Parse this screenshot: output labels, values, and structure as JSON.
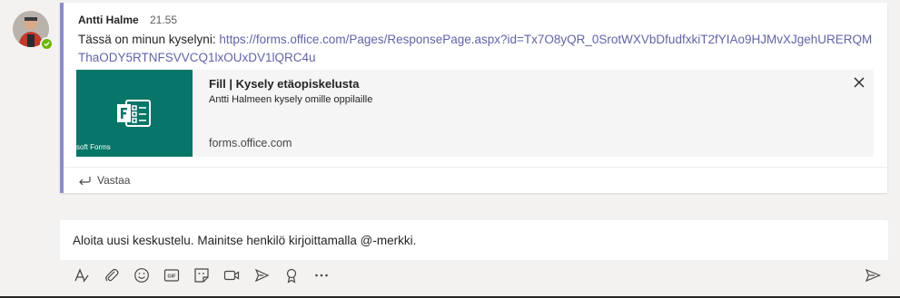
{
  "post": {
    "author": "Antti Halme",
    "time": "21.55",
    "message_prefix": "Tässä on minun kyselyni: ",
    "link": "https://forms.office.com/Pages/ResponsePage.aspx?id=Tx7O8yQR_0SrotWXVbDfudfxkiT2fYIAo9HJMvXJgehURERQMThaODY5RTNFSVVCQ1lxOUxDV1lQRC4u",
    "reply_label": "Vastaa"
  },
  "preview_card": {
    "thumbnail_caption": "soft Forms",
    "title": "Fill | Kysely etäopiskelusta",
    "description": "Antti Halmeen kysely omille oppilaille",
    "domain": "forms.office.com",
    "thumbnail_color": "#077568"
  },
  "compose": {
    "placeholder": "Aloita uusi keskustelu. Mainitse henkilö kirjoittamalla @-merkki."
  },
  "toolbar_icons": [
    "format-icon",
    "attach-icon",
    "emoji-icon",
    "gif-icon",
    "sticker-icon",
    "meet-now-icon",
    "stream-icon",
    "praise-icon",
    "more-options-icon",
    "send-icon"
  ],
  "colors": {
    "accent": "#6264a7",
    "post_border": "#8b8cc7",
    "presence_available": "#6bb700"
  }
}
